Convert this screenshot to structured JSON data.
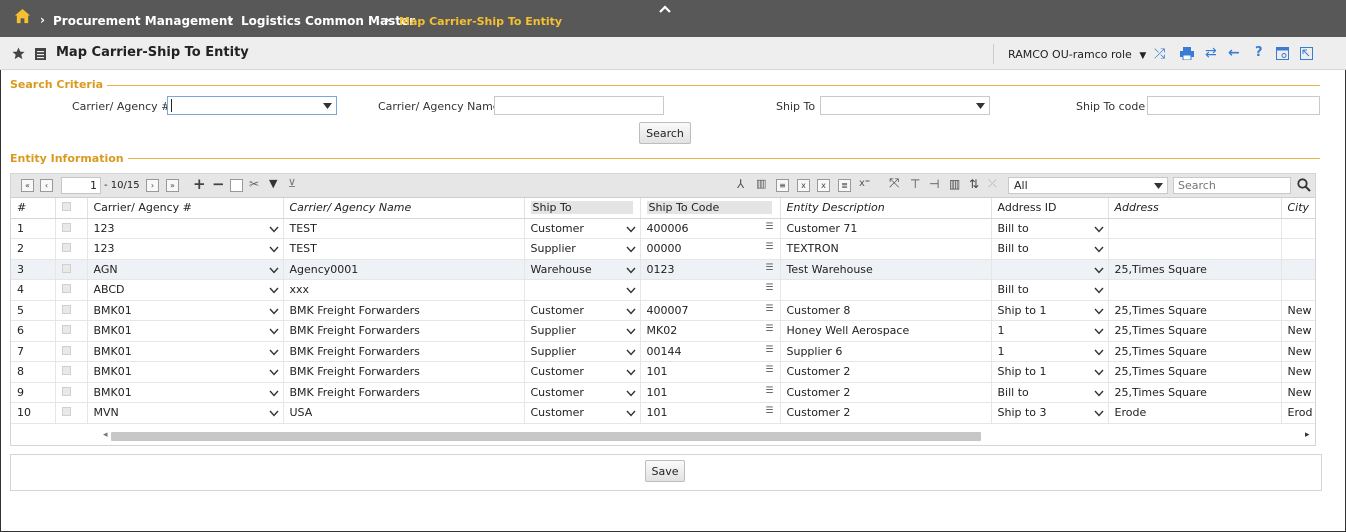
{
  "breadcrumb": {
    "items": [
      "Procurement Management",
      "Logistics Common Master"
    ],
    "current": "Map Carrier-Ship To Entity"
  },
  "title": "Map Carrier-Ship To Entity",
  "role": "RAMCO OU-ramco role",
  "search": {
    "legend": "Search Criteria",
    "carrier_no_label": "Carrier/ Agency #",
    "carrier_no_value": "",
    "carrier_name_label": "Carrier/ Agency Name",
    "carrier_name_value": "",
    "ship_to_label": "Ship To",
    "ship_to_value": "",
    "ship_to_code_label": "Ship To code",
    "ship_to_code_value": "",
    "search_button": "Search"
  },
  "entity": {
    "legend": "Entity Information",
    "pager_value": "1",
    "pager_total": "- 10/15",
    "filter_value": "All",
    "search_placeholder": "Search",
    "columns": [
      "#",
      "",
      "Carrier/ Agency #",
      "Carrier/ Agency Name",
      "Ship To",
      "Ship To Code",
      "Entity Description",
      "Address ID",
      "Address",
      "City"
    ],
    "rows": [
      {
        "no": "1",
        "carrier": "123",
        "name": "TEST",
        "shipto": "Customer",
        "code": "400006",
        "desc": "Customer 71",
        "addrid": "Bill to",
        "addr": "",
        "city": ""
      },
      {
        "no": "2",
        "carrier": "123",
        "name": "TEST",
        "shipto": "Supplier",
        "code": "00000",
        "desc": "TEXTRON",
        "addrid": "Bill to",
        "addr": "",
        "city": ""
      },
      {
        "no": "3",
        "carrier": "AGN",
        "name": "Agency0001",
        "shipto": "Warehouse",
        "code": "0123",
        "desc": "Test Warehouse",
        "addrid": "",
        "addr": "25,Times Square",
        "city": ""
      },
      {
        "no": "4",
        "carrier": "ABCD",
        "name": "xxx",
        "shipto": "",
        "code": "",
        "desc": "",
        "addrid": "Bill to",
        "addr": "",
        "city": ""
      },
      {
        "no": "5",
        "carrier": "BMK01",
        "name": "BMK Freight Forwarders",
        "shipto": "Customer",
        "code": "400007",
        "desc": "Customer 8",
        "addrid": "Ship to 1",
        "addr": "25,Times Square",
        "city": "New"
      },
      {
        "no": "6",
        "carrier": "BMK01",
        "name": "BMK Freight Forwarders",
        "shipto": "Supplier",
        "code": "MK02",
        "desc": "Honey Well Aerospace",
        "addrid": "1",
        "addr": "25,Times Square",
        "city": "New"
      },
      {
        "no": "7",
        "carrier": "BMK01",
        "name": "BMK Freight Forwarders",
        "shipto": "Supplier",
        "code": "00144",
        "desc": "Supplier 6",
        "addrid": "1",
        "addr": "25,Times Square",
        "city": "New"
      },
      {
        "no": "8",
        "carrier": "BMK01",
        "name": "BMK Freight Forwarders",
        "shipto": "Customer",
        "code": "101",
        "desc": "Customer 2",
        "addrid": "Ship to 1",
        "addr": "25,Times Square",
        "city": "New"
      },
      {
        "no": "9",
        "carrier": "BMK01",
        "name": "BMK Freight Forwarders",
        "shipto": "Customer",
        "code": "101",
        "desc": "Customer 2",
        "addrid": "Bill to",
        "addr": "25,Times Square",
        "city": "New"
      },
      {
        "no": "10",
        "carrier": "MVN",
        "name": "USA",
        "shipto": "Customer",
        "code": "101",
        "desc": "Customer 2",
        "addrid": "Ship to 3",
        "addr": "Erode",
        "city": "Erod"
      }
    ]
  },
  "save_button": "Save"
}
